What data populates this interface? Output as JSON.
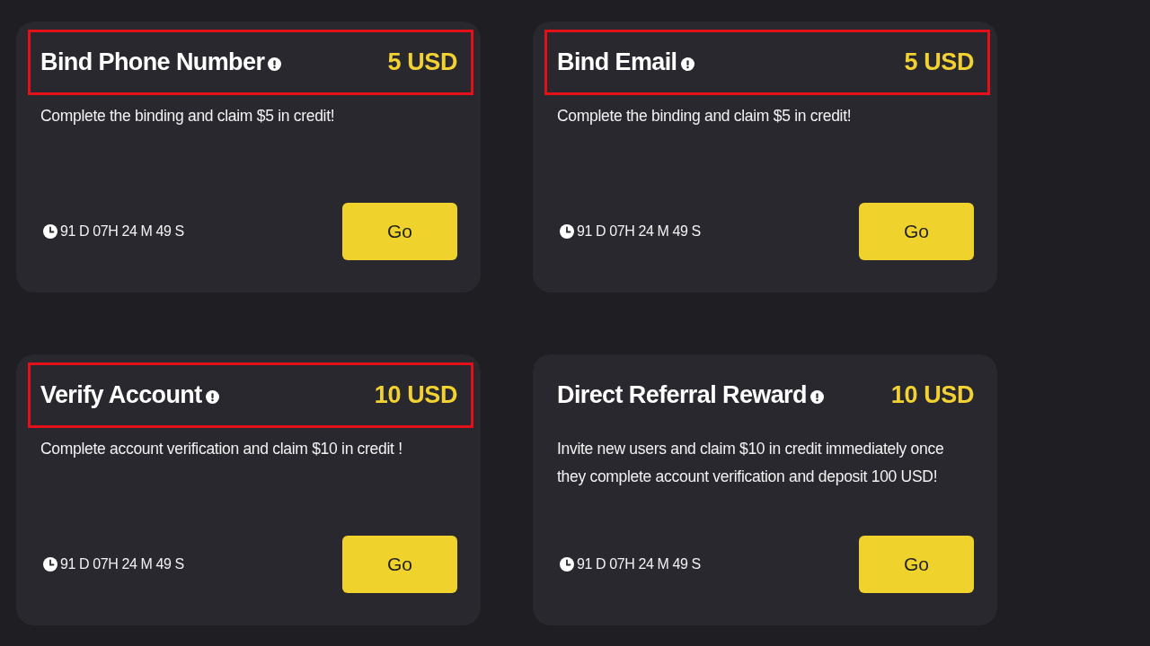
{
  "cards": [
    {
      "title": "Bind Phone Number",
      "reward": "5 USD",
      "highlighted": true,
      "description": "Complete the binding and claim $5 in credit!",
      "countdown": "91 D 07H 24 M 49 S",
      "button": "Go"
    },
    {
      "title": "Bind Email",
      "reward": "5 USD",
      "highlighted": true,
      "description": "Complete the binding and claim $5 in credit!",
      "countdown": "91 D 07H 24 M 49 S",
      "button": "Go"
    },
    {
      "title": "Verify Account",
      "reward": "10 USD",
      "highlighted": true,
      "description": "Complete account verification and claim $10 in credit !",
      "countdown": "91 D 07H 24 M 49 S",
      "button": "Go"
    },
    {
      "title": "Direct Referral Reward",
      "reward": "10 USD",
      "highlighted": false,
      "description": "Invite new users and claim $10 in credit immediately once they complete account verification and deposit 100 USD!",
      "countdown": "91 D 07H 24 M 49 S",
      "button": "Go"
    }
  ]
}
